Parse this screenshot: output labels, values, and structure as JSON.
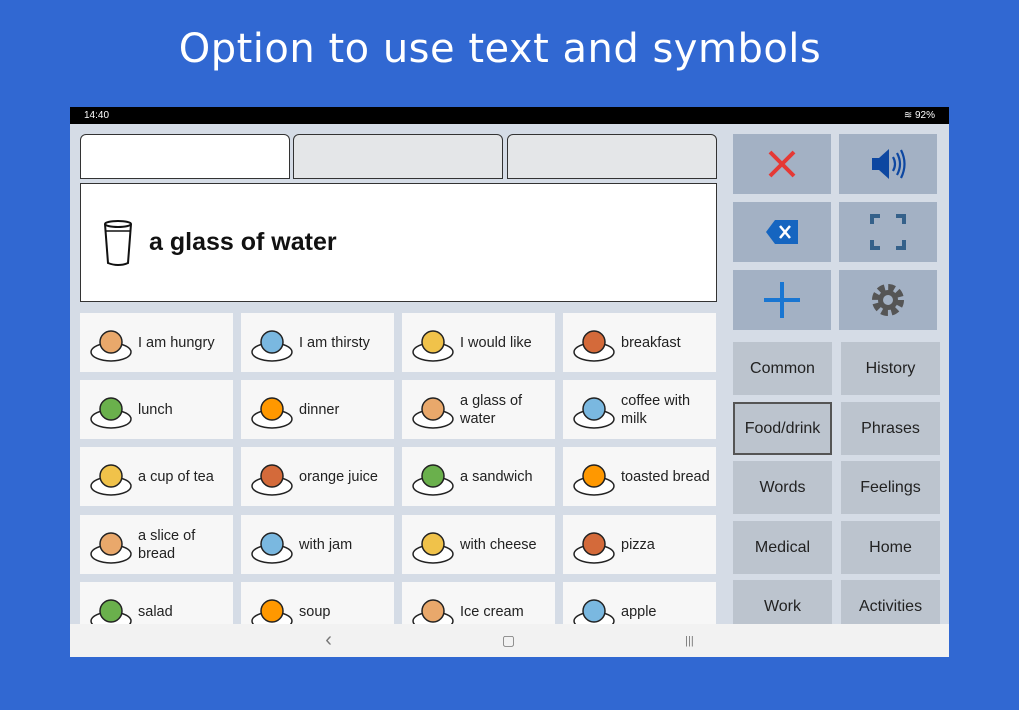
{
  "headline": "Option to use text and symbols",
  "status": {
    "time": "14:40",
    "battery": "92%"
  },
  "message": {
    "text": "a glass of water",
    "icon": "glass-icon"
  },
  "tabs": [
    {
      "label": ""
    },
    {
      "label": ""
    },
    {
      "label": ""
    }
  ],
  "controls": [
    {
      "name": "clear",
      "icon": "x-icon",
      "color": "#e53935"
    },
    {
      "name": "speak",
      "icon": "speaker-icon",
      "color": "#0d47a1"
    },
    {
      "name": "backspace",
      "icon": "backspace-icon",
      "color": "#1565c0"
    },
    {
      "name": "fullscreen",
      "icon": "fullscreen-icon",
      "color": "#35618a"
    },
    {
      "name": "add",
      "icon": "plus-icon",
      "color": "#1976d2"
    },
    {
      "name": "settings",
      "icon": "gear-icon",
      "color": "#555"
    }
  ],
  "grid": [
    [
      "I am hungry",
      "I am thirsty",
      "I would like",
      "breakfast"
    ],
    [
      "lunch",
      "dinner",
      "a glass of water",
      "coffee with milk"
    ],
    [
      "a cup of tea",
      "orange juice",
      "a sandwich",
      "toasted bread"
    ],
    [
      "a slice of bread",
      "with jam",
      "with cheese",
      "pizza"
    ],
    [
      "salad",
      "soup",
      "Ice cream",
      "apple"
    ]
  ],
  "categories": [
    [
      "Common",
      "History"
    ],
    [
      "Food/drink",
      "Phrases"
    ],
    [
      "Words",
      "Feelings"
    ],
    [
      "Medical",
      "Home"
    ],
    [
      "Work",
      "Activities"
    ]
  ],
  "selected_category": "Food/drink",
  "nav": {
    "back": "‹",
    "home": "▢",
    "recent": "|||"
  }
}
